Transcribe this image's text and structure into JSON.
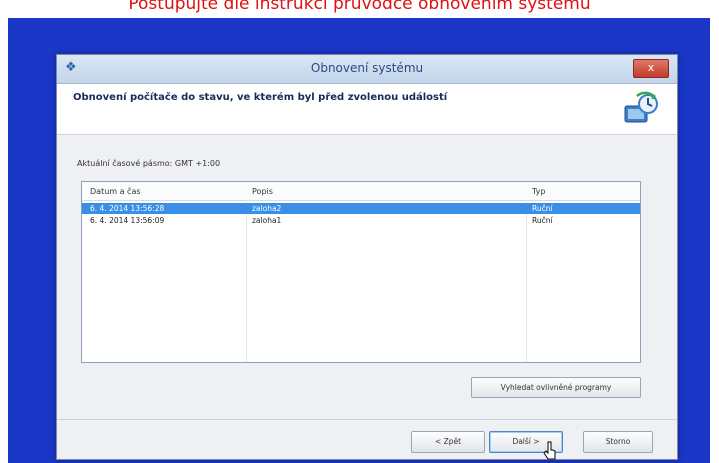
{
  "caption": "Postupujte dle instrukcí průvodce obnovením systému",
  "window": {
    "title": "Obnovení systému",
    "close_label": "x",
    "heading": "Obnovení počítače do stavu, ve kterém byl před zvolenou událostí"
  },
  "timezone_label": "Aktuální časové pásmo: GMT +1:00",
  "list": {
    "columns": [
      "Datum a čas",
      "Popis",
      "Typ"
    ],
    "rows": [
      {
        "date": "6. 4. 2014 13:56:28",
        "desc": "zaloha2",
        "type": "Ruční",
        "selected": true
      },
      {
        "date": "6. 4. 2014 13:56:09",
        "desc": "zaloha1",
        "type": "Ruční",
        "selected": false
      }
    ]
  },
  "buttons": {
    "scan": "Vyhledat ovlivněné programy",
    "back": "< Zpět",
    "next": "Další >",
    "cancel": "Storno"
  },
  "icons": [
    "app-icon",
    "system-restore-icon",
    "cursor-icon"
  ],
  "colors": {
    "desktop": "#1a37c8",
    "selection": "#3a8ee6",
    "caption": "#e01010"
  }
}
